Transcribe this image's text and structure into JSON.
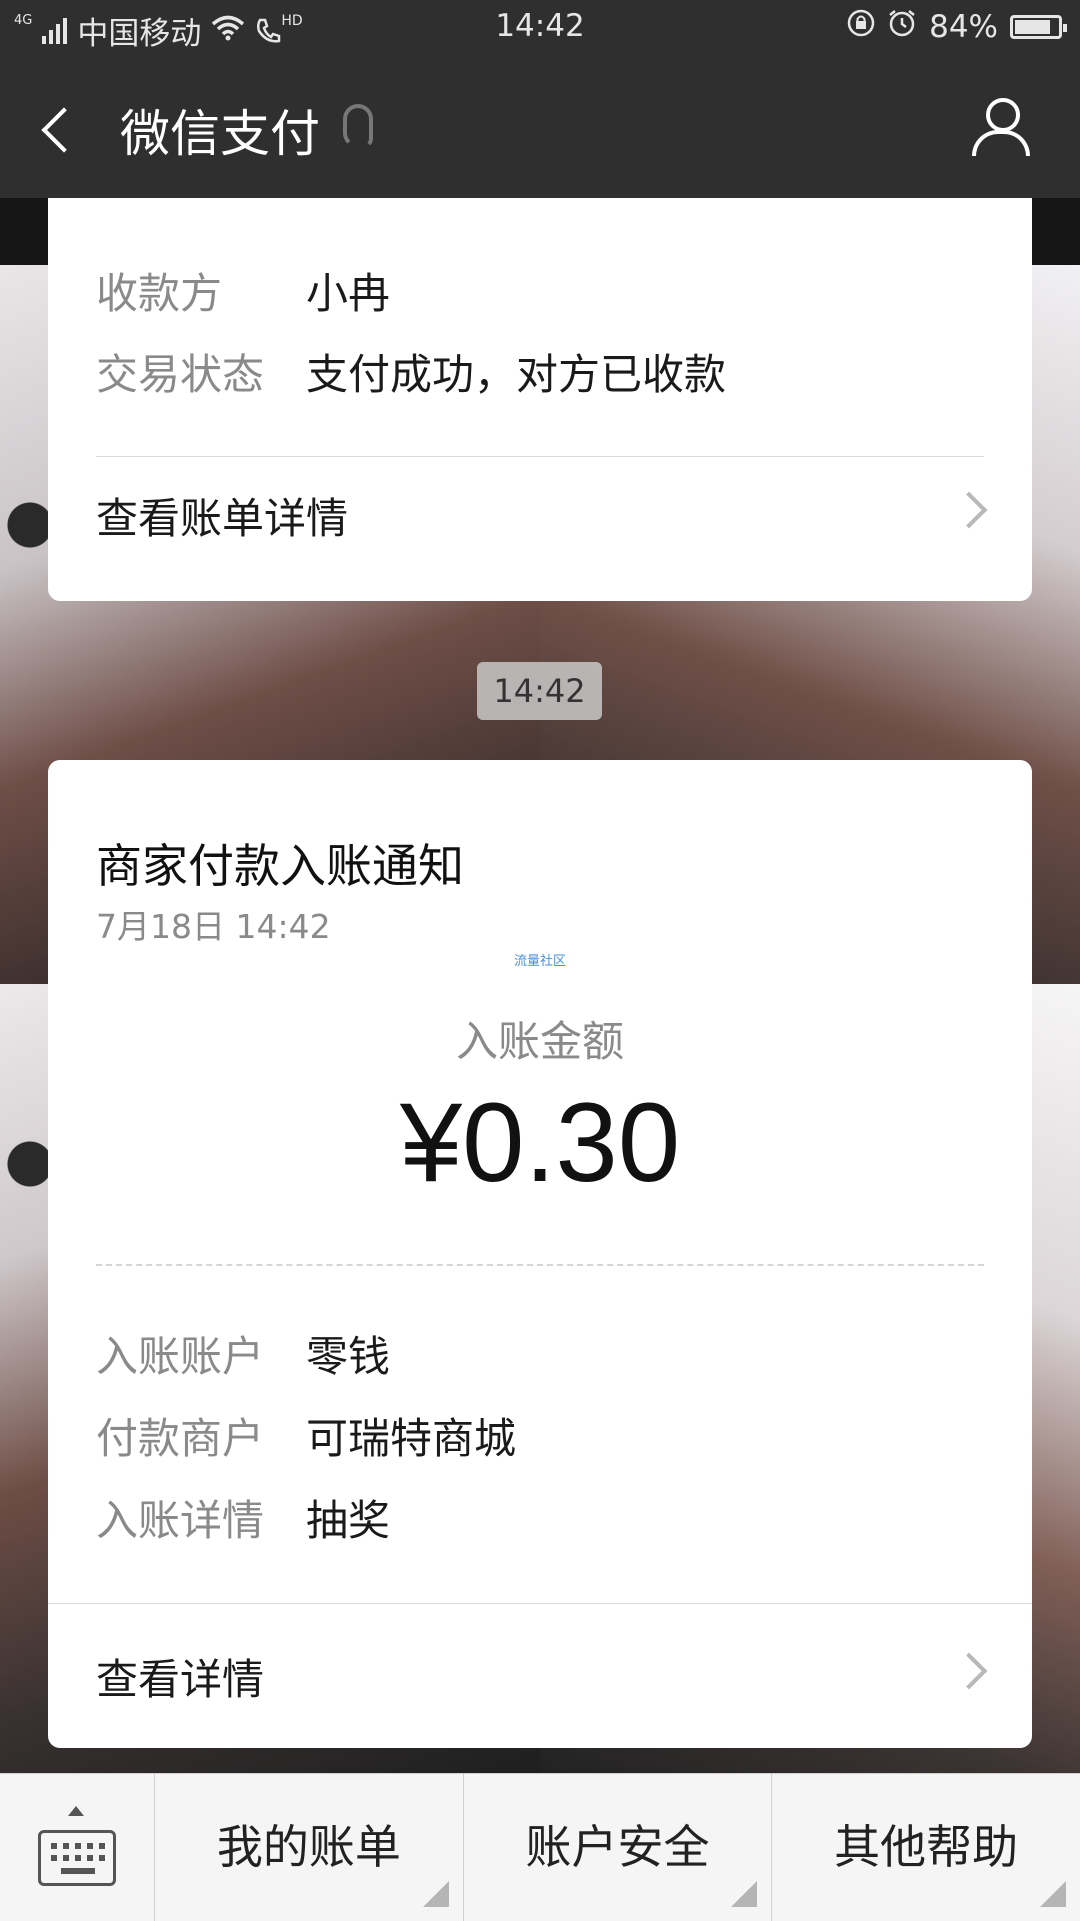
{
  "status_bar": {
    "network": "4G",
    "carrier": "中国移动",
    "hd": "HD",
    "time": "14:42",
    "battery": "84%",
    "battery_level": 0.84
  },
  "nav": {
    "title": "微信支付"
  },
  "message1": {
    "rows": [
      {
        "label": "收款方",
        "value": "小冉"
      },
      {
        "label": "交易状态",
        "value": "支付成功，对方已收款"
      }
    ],
    "link": "查看账单详情"
  },
  "timestamp": "14:42",
  "message2": {
    "title": "商家付款入账通知",
    "date": "7月18日  14:42",
    "watermark": "流量社区",
    "amount_label": "入账金额",
    "amount": "¥0.30",
    "rows": [
      {
        "label": "入账账户",
        "value": "零钱"
      },
      {
        "label": "付款商户",
        "value": "可瑞特商城"
      },
      {
        "label": "入账详情",
        "value": "抽奖"
      }
    ],
    "link": "查看详情"
  },
  "bottom_menu": {
    "items": [
      "我的账单",
      "账户安全",
      "其他帮助"
    ]
  }
}
